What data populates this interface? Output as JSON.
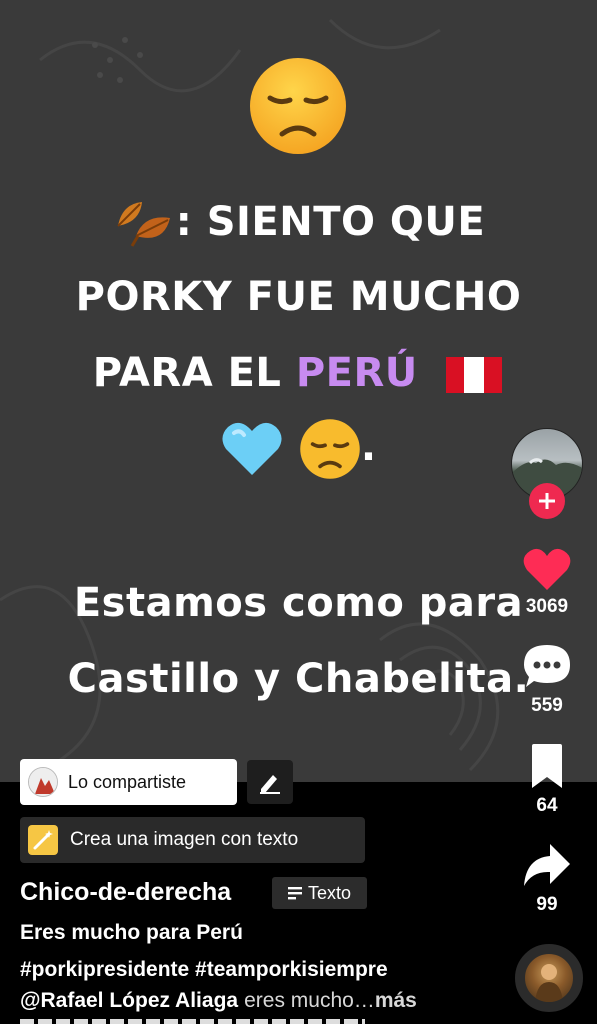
{
  "video": {
    "caption_prefix": ": SIENTO QUE",
    "caption_line2": "PORKY FUE MUCHO",
    "caption_line3_a": "PARA EL ",
    "caption_line3_highlight": "PERÚ",
    "caption_line4_suffix": ".",
    "caption_line5": "Estamos como para",
    "caption_line6": "Castillo y Chabelita.",
    "highlight_color": "#c78bf0",
    "emojis": [
      "disappointed-face",
      "fallen-leaf",
      "peru-flag",
      "light-blue-heart"
    ]
  },
  "chips": {
    "shared_label": "Lo compartiste",
    "create_label": "Crea una imagen con texto"
  },
  "post": {
    "username": "Chico-de-derecha",
    "badge_label": "Texto",
    "title": "Eres mucho para Perú",
    "hashtags": "#porkipresidente #teamporkisiempre",
    "mention": "@Rafael López Aliaga",
    "rest": "eres mucho…",
    "more": "más"
  },
  "rail": {
    "likes": "3069",
    "comments": "559",
    "saves": "64",
    "shares": "99",
    "like_color": "#fe2c55",
    "follow_color": "#ef2950"
  }
}
